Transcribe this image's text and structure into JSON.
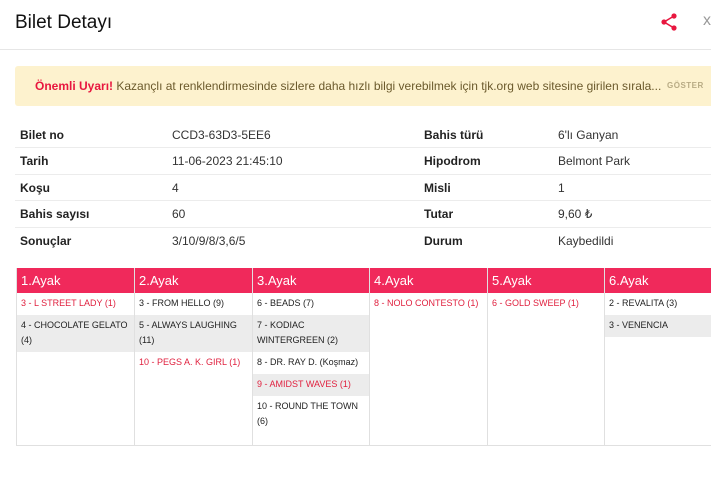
{
  "header": {
    "title": "Bilet Detayı",
    "share_icon": "share-icon",
    "close_char": "x"
  },
  "warning": {
    "title": "Önemli Uyarı!",
    "message": "Kazançlı at renklendirmesinde sizlere daha hızlı bilgi verebilmek için tjk.org web sitesine girilen sırala...",
    "button": "GÖSTER"
  },
  "ticket": {
    "rows": [
      {
        "label1": "Bilet no",
        "value1": "CCD3-63D3-5EE6",
        "label2": "Bahis türü",
        "value2": "6'lı Ganyan"
      },
      {
        "label1": "Tarih",
        "value1": "11-06-2023 21:45:10",
        "label2": "Hipodrom",
        "value2": "Belmont Park"
      },
      {
        "label1": "Koşu",
        "value1": "4",
        "label2": "Misli",
        "value2": "1"
      },
      {
        "label1": "Bahis sayısı",
        "value1": "60",
        "label2": "Tutar",
        "value2": "9,60 ₺"
      },
      {
        "label1": "Sonuçlar",
        "value1": "3/10/9/8/3,6/5",
        "label2": "Durum",
        "value2": "Kaybedildi"
      }
    ]
  },
  "colors": {
    "accent": "#f0295b",
    "winner_text": "#e0213f",
    "warning_bg": "#fdf2ce"
  },
  "legs": [
    {
      "title": "1.Ayak",
      "horses": [
        {
          "name": "3 - L STREET LADY (1)",
          "winner": true
        },
        {
          "name": "4 - CHOCOLATE GELATO (4)",
          "winner": false
        }
      ]
    },
    {
      "title": "2.Ayak",
      "horses": [
        {
          "name": "3 - FROM HELLO (9)",
          "winner": false
        },
        {
          "name": "5 - ALWAYS LAUGHING (11)",
          "winner": false
        },
        {
          "name": "10 - PEGS A. K. GIRL (1)",
          "winner": true
        }
      ]
    },
    {
      "title": "3.Ayak",
      "horses": [
        {
          "name": "6 - BEADS (7)",
          "winner": false
        },
        {
          "name": "7 - KODIAC WINTERGREEN (2)",
          "winner": false
        },
        {
          "name": "8 - DR. RAY D. (Koşmaz)",
          "winner": false
        },
        {
          "name": "9 - AMIDST WAVES (1)",
          "winner": true
        },
        {
          "name": "10 - ROUND THE TOWN (6)",
          "winner": false
        }
      ]
    },
    {
      "title": "4.Ayak",
      "horses": [
        {
          "name": "8 - NOLO CONTESTO (1)",
          "winner": true
        }
      ]
    },
    {
      "title": "5.Ayak",
      "horses": [
        {
          "name": "6 - GOLD SWEEP (1)",
          "winner": true
        }
      ]
    },
    {
      "title": "6.Ayak",
      "horses": [
        {
          "name": "2 - REVALITA (3)",
          "winner": false
        },
        {
          "name": "3 - VENENCIA",
          "winner": false
        }
      ]
    }
  ]
}
